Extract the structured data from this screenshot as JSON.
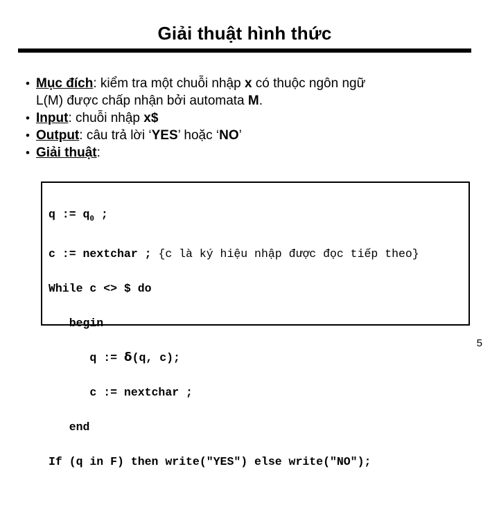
{
  "slide": {
    "title": "Giải thuật hình thức",
    "page_number": "5",
    "bullet_marker": "•"
  },
  "bullets": [
    {
      "lead": "Mục đích",
      "colon": ":",
      "rest_line1_a": " kiểm tra một chuỗi nhập ",
      "bold1": "x",
      "rest_line1_b": " có thuộc ngôn ngữ",
      "line2_a": "L(M) được chấp nhận bởi automata ",
      "bold2": "M",
      "line2_b": "."
    },
    {
      "lead": "Input",
      "colon": ":",
      "rest_a": " chuỗi nhập ",
      "bold1": "x$",
      "rest_b": ""
    },
    {
      "lead": "Output",
      "colon": ":",
      "rest_a": " câu trả lời ‘",
      "bold1": "YES",
      "rest_b": "’ hoặc ‘",
      "bold2": "NO",
      "rest_c": "’"
    },
    {
      "lead": "Giải thuật",
      "colon": ":"
    }
  ],
  "code": {
    "line1_a": "q := q",
    "line1_sub": "0",
    "line1_b": " ;",
    "line2_code": "c := nextchar ; ",
    "line2_comment": "{c là ký hiệu nhập được đọc tiếp theo}",
    "line3": "While c <> $ do",
    "line4": "   begin",
    "line5_a": "      q := ",
    "line5_delta": "δ",
    "line5_b": "(q, c);",
    "line6": "      c := nextchar ;",
    "line7": "   end",
    "line8": "If (q in F) then write(\"YES\") else write(\"NO\");"
  }
}
